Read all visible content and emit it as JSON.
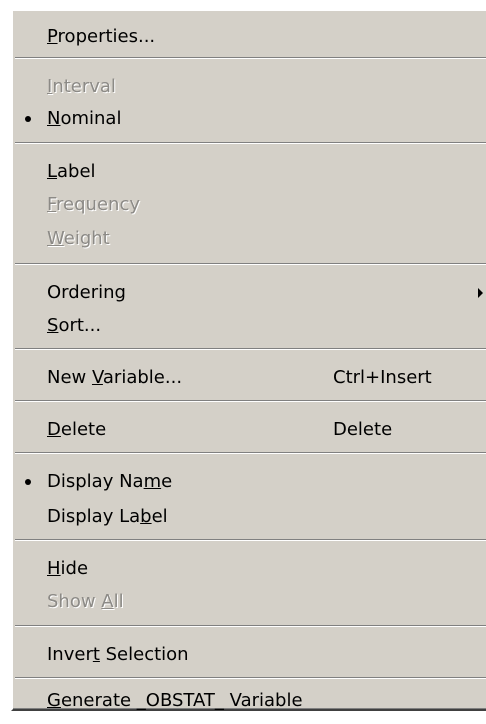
{
  "menu": {
    "items": [
      {
        "pre": "",
        "key": "P",
        "post": "roperties...",
        "enabled": true
      },
      {
        "pre": "",
        "key": "I",
        "post": "nterval",
        "enabled": false
      },
      {
        "pre": "",
        "key": "N",
        "post": "ominal",
        "enabled": true,
        "checked": true
      },
      {
        "pre": "",
        "key": "L",
        "post": "abel",
        "enabled": true
      },
      {
        "pre": "",
        "key": "F",
        "post": "requency",
        "enabled": false
      },
      {
        "pre": "",
        "key": "W",
        "post": "eight",
        "enabled": false
      },
      {
        "pre": "Ordering",
        "key": "",
        "post": "",
        "enabled": true,
        "submenu": true
      },
      {
        "pre": "",
        "key": "S",
        "post": "ort...",
        "enabled": true
      },
      {
        "pre": "New ",
        "key": "V",
        "post": "ariable...",
        "shortcut": "Ctrl+Insert",
        "enabled": true
      },
      {
        "pre": "",
        "key": "D",
        "post": "elete",
        "shortcut": "Delete",
        "enabled": true
      },
      {
        "pre": "Display Na",
        "key": "m",
        "post": "e",
        "enabled": true,
        "checked": true
      },
      {
        "pre": "Display La",
        "key": "b",
        "post": "el",
        "enabled": true
      },
      {
        "pre": "",
        "key": "H",
        "post": "ide",
        "enabled": true
      },
      {
        "pre": "Show ",
        "key": "A",
        "post": "ll",
        "enabled": false
      },
      {
        "pre": "Inver",
        "key": "t",
        "post": " Selection",
        "enabled": true
      },
      {
        "pre": "",
        "key": "G",
        "post": "enerate _OBSTAT_ Variable",
        "enabled": true
      }
    ]
  },
  "colors": {
    "menu_bg": "#d4d0c8",
    "text": "#000000",
    "disabled_text": "#8c8a86",
    "separator_dark": "#808080",
    "separator_light": "#ffffff"
  },
  "icons": {
    "check": "bullet-icon",
    "submenu": "submenu-arrow-icon"
  }
}
